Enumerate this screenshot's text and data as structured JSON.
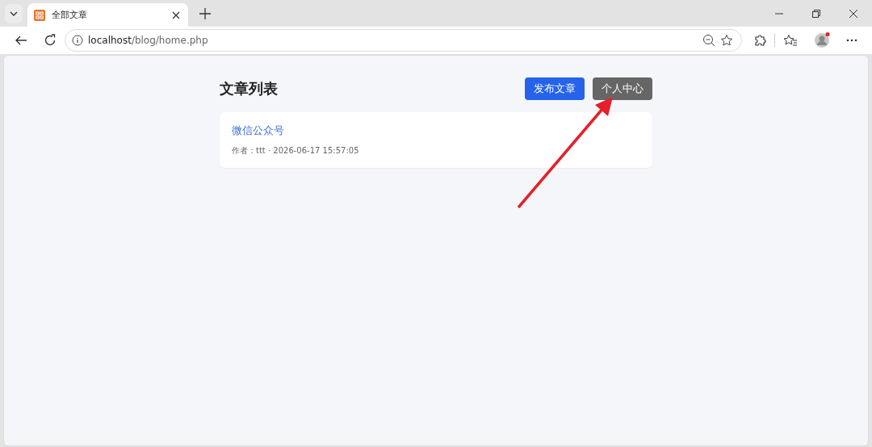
{
  "browser": {
    "tab_title": "全部文章",
    "url_host": "localhost",
    "url_path": "/blog/home.php"
  },
  "page": {
    "title": "文章列表",
    "buttons": [
      {
        "label": "发布文章",
        "kind": "primary"
      },
      {
        "label": "个人中心",
        "kind": "secondary"
      }
    ],
    "articles": [
      {
        "title": "微信公众号",
        "meta": "作者：ttt · 2026-06-17 15:57:05"
      }
    ]
  },
  "annotation": {
    "kind": "arrow",
    "color": "#e5202a"
  }
}
